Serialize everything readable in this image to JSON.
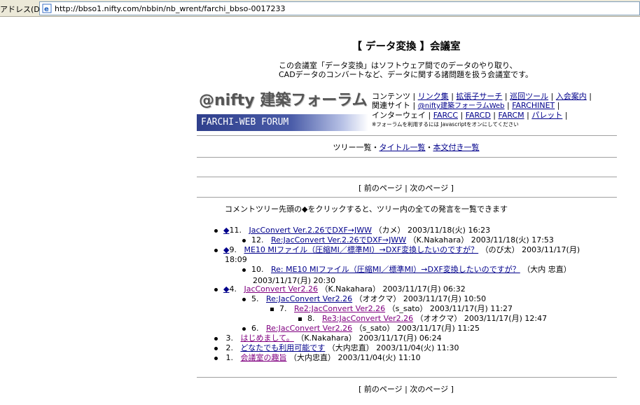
{
  "browser": {
    "address_label": "アドレス(D)",
    "url": "http://bbso1.nifty.com/nbbin/nb_wrent/farchi_bbso-0017233"
  },
  "page": {
    "title": "【 データ変換 】会議室",
    "description_line1": "この会議室「データ変換」はソフトウェア間でのデータのやり取り、",
    "description_line2": "CADデータのコンバートなど、データに関する諸問題を扱う会議室です。",
    "logo_top": "@nifty 建築フォーラム",
    "logo_bottom": "FARCHI-WEB FORUM"
  },
  "nav": {
    "row1_contents": "コンテンツ",
    "links_row1": [
      "リンク集",
      "拡張子サーチ",
      "巡回ツール",
      "入会案内"
    ],
    "row2_label": "関連サイト",
    "links_row2": [
      "@nifty建築フォーラムWeb",
      "FARCHINET"
    ],
    "row3_label": "インターウェイ",
    "links_row3": [
      "FARCC",
      "FARCD",
      "FARCM",
      "パレット"
    ],
    "note": "※フォーラムを利用するには Javascriptをオンにしてください"
  },
  "tree_nav": {
    "tree_list": "ツリー一覧",
    "title_list": "タイトル一覧",
    "body_list": "本文付き一覧"
  },
  "pager": {
    "prev": "前のページ",
    "next": "次のページ"
  },
  "info_text": "コメントツリー先頭の◆をクリックすると、ツリー内の全ての発言を一覧できます",
  "posts": [
    {
      "num": "11.",
      "diamond": "◆",
      "title": "JacConvert Ver.2.26でDXF→JWW",
      "author": "（カメ）",
      "date": "2003/11/18(火) 16:23"
    },
    {
      "num": "12.",
      "title": "Re:JacConvert Ver.2.26でDXF→JWW",
      "author": "（K.Nakahara）",
      "date": "2003/11/18(火) 17:53"
    },
    {
      "num": "9.",
      "diamond": "◆",
      "title": "ME10 MIファイル（圧縮MI／標準MI）→DXF変換したいのですが？",
      "author": "（のび太）",
      "date": "2003/11/17(月)",
      "date_wrap": "18:09"
    },
    {
      "num": "10.",
      "title": "Re: ME10 MIファイル（圧縮MI／標準MI）→DXF変換したいのですが？",
      "author": "（大内 忠直）",
      "date_wrap": "2003/11/17(月) 20:30"
    },
    {
      "num": "4.",
      "diamond": "◆",
      "title": "JacConvert Ver2.26",
      "author": "（K.Nakahara）",
      "date": "2003/11/17(月) 06:32"
    },
    {
      "num": "5.",
      "title": "Re:JacConvert Ver2.26",
      "author": "（オオクマ）",
      "date": "2003/11/17(月) 10:50"
    },
    {
      "num": "7.",
      "title": "Re2:JacConvert Ver2.26",
      "author": "（s_sato）",
      "date": "2003/11/17(月) 11:27"
    },
    {
      "num": "8.",
      "title": "Re3:JacConvert Ver2.26",
      "author": "（オオクマ）",
      "date": "2003/11/17(月) 12:47"
    },
    {
      "num": "6.",
      "title": "Re:JacConvert Ver2.26",
      "author": "（s_sato）",
      "date": "2003/11/17(月) 11:25"
    },
    {
      "num": "3.",
      "title": "はじめまして。",
      "author": "（K.Nakahara）",
      "date": "2003/11/17(月) 06:24"
    },
    {
      "num": "2.",
      "title": "どなたでも利用可能です",
      "author": "（大内忠直）",
      "date": "2003/11/04(火) 11:30"
    },
    {
      "num": "1.",
      "title": "会議室の趣旨",
      "author": "（大内忠直）",
      "date": "2003/11/04(火) 11:10"
    }
  ],
  "colors": {
    "link": "#00008b",
    "visited": "#800080",
    "logo_band": "#2f3f8c"
  }
}
